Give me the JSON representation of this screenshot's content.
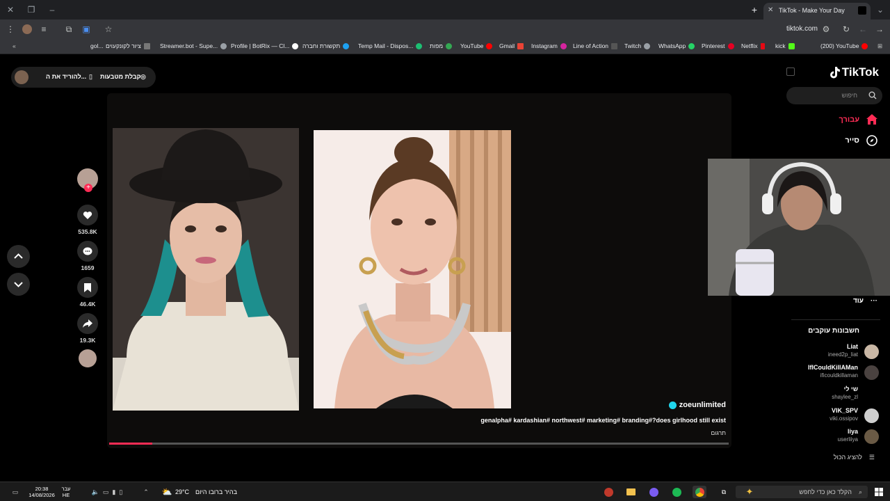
{
  "browser": {
    "tab_title": "TikTok - Make Your Day",
    "url": "tiktok.com",
    "bookmarks": [
      "(200) YouTube",
      "kick",
      "Netflix",
      "Pinterest",
      "WhatsApp",
      "Twitch",
      "Line of Action",
      "Instagram",
      "Gmail",
      "YouTube",
      "מפות",
      "Temp Mail - Dispos...",
      "תקשורת וחברה",
      "Profile | BotRix — Cl...",
      "Streamer.bot - Supe...",
      "ציור לקונקעוים",
      "gol..."
    ]
  },
  "topbar": {
    "coins_label": "קבלת מטבעות",
    "download_label": "להוריד את ה..."
  },
  "actions": {
    "likes": "535.8K",
    "comments": "1659",
    "saves": "46.4K",
    "shares": "19.3K"
  },
  "video": {
    "creator": "zoeunlimited",
    "caption": "genalpha# kardashian# northwest# marketing# branding#?does girlhood still exist",
    "translate_label": "תרגום",
    "progress": 0.07
  },
  "sidebar": {
    "logo": "TikTok",
    "search_placeholder": "חיפוש",
    "nav": [
      {
        "label": "עבורך",
        "icon": "home-icon",
        "active": true
      },
      {
        "label": "סייר",
        "icon": "compass-icon",
        "active": false
      }
    ],
    "more_label": "עוד",
    "following_title": "חשבונות עוקבים",
    "accounts": [
      {
        "name": "Liat",
        "user": "ineed2p_liat",
        "color": "#c9b7a5"
      },
      {
        "name": "IfICouldKillAMan",
        "user": "ificouldkillaman",
        "color": "#4a4240"
      },
      {
        "name": "שי לי",
        "user": "shaylee_zl",
        "color": "#000000"
      },
      {
        "name": "VIK_SPV",
        "user": "viki.ossipov",
        "color": "#cfcfcf"
      },
      {
        "name": "liya",
        "user": "userliiya",
        "color": "#6a5a45"
      }
    ],
    "show_all_label": "להציג הכול"
  },
  "taskbar": {
    "search_placeholder": "הקלד כאן כדי לחפש",
    "weather": "29°C",
    "weather_text": "בהיר ברובו היום",
    "time": "20:38",
    "date": "14/08/2026",
    "lang1": "עבר",
    "lang2": "HE"
  },
  "colors": {
    "accent": "#fe2c55",
    "verified": "#20d5ec"
  }
}
